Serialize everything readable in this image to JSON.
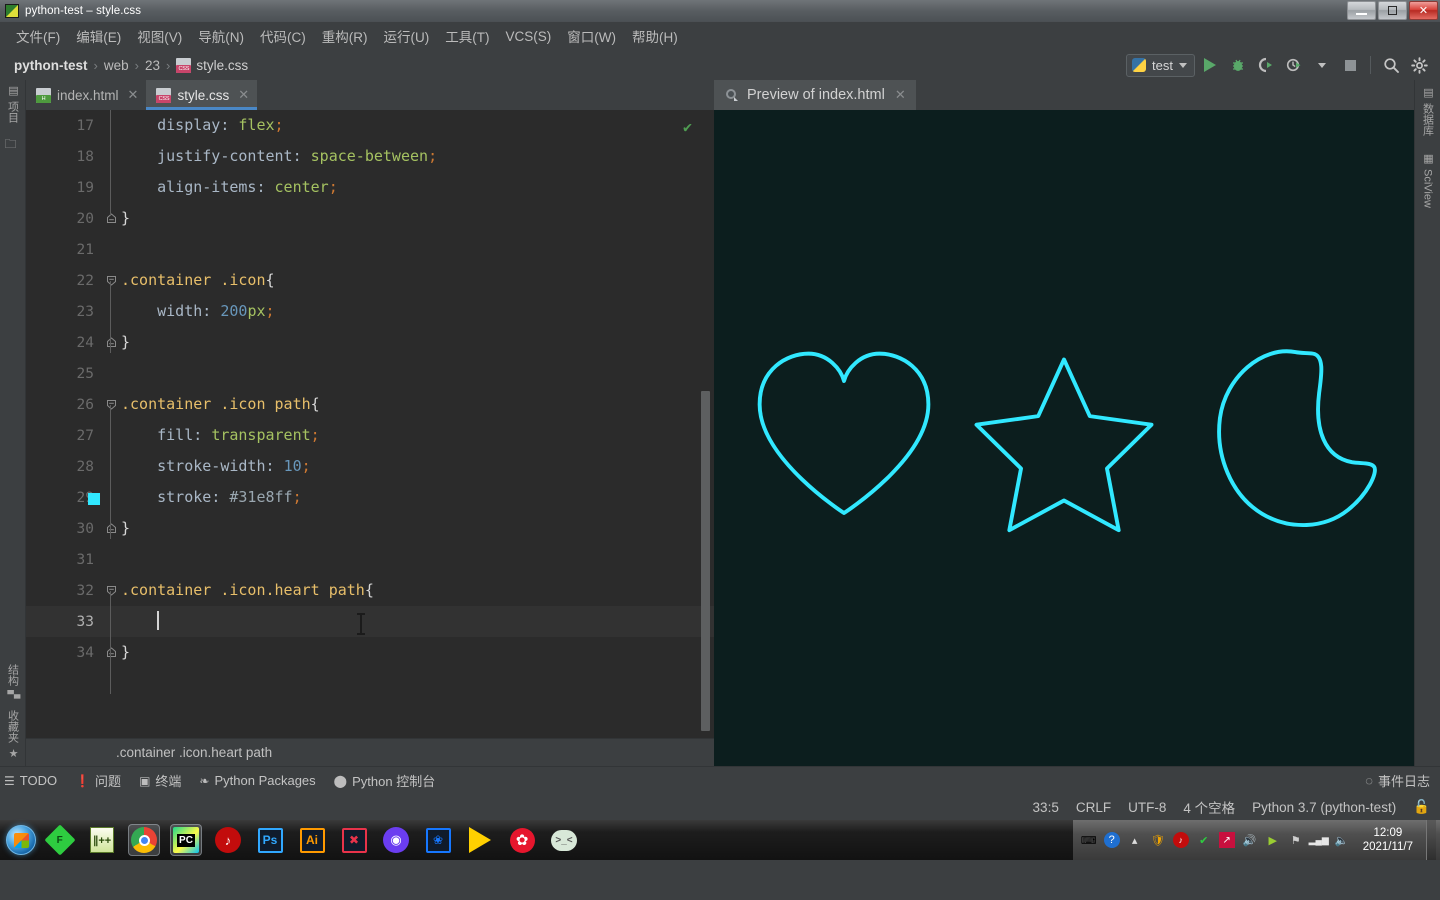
{
  "window": {
    "title": "python-test – style.css",
    "icon": "pycharm-icon",
    "buttons": {
      "minimize": "—",
      "maximize": "❐",
      "close": "✕"
    }
  },
  "menubar": {
    "items": [
      {
        "label": "文件(F)",
        "name": "menu-file"
      },
      {
        "label": "编辑(E)",
        "name": "menu-edit"
      },
      {
        "label": "视图(V)",
        "name": "menu-view"
      },
      {
        "label": "导航(N)",
        "name": "menu-navigate"
      },
      {
        "label": "代码(C)",
        "name": "menu-code"
      },
      {
        "label": "重构(R)",
        "name": "menu-refactor"
      },
      {
        "label": "运行(U)",
        "name": "menu-run"
      },
      {
        "label": "工具(T)",
        "name": "menu-tools"
      },
      {
        "label": "VCS(S)",
        "name": "menu-vcs"
      },
      {
        "label": "窗口(W)",
        "name": "menu-window"
      },
      {
        "label": "帮助(H)",
        "name": "menu-help"
      }
    ]
  },
  "toolbar": {
    "breadcrumb": {
      "project": "python-test",
      "folder": "web",
      "subfolder": "23",
      "file": "style.css",
      "separator": "›"
    },
    "run_config": {
      "label": "test",
      "icon": "python-icon"
    },
    "actions": [
      {
        "name": "run-button",
        "glyph": "▶"
      },
      {
        "name": "debug-button",
        "glyph": "🐞"
      },
      {
        "name": "run-with-coverage-button",
        "glyph": "▶"
      },
      {
        "name": "profile-button",
        "glyph": "▶"
      },
      {
        "name": "stop-button",
        "glyph": "■"
      },
      {
        "name": "search-everywhere-button",
        "glyph": "🔍"
      },
      {
        "name": "settings-button",
        "glyph": "⚙"
      }
    ]
  },
  "left_rail": {
    "top": [
      {
        "label": "项目",
        "name": "tool-window-project",
        "icon": "project-icon"
      },
      {
        "label": "",
        "name": "tool-window-folder",
        "icon": "folder-icon"
      }
    ],
    "bottom": [
      {
        "label": "结构",
        "name": "tool-window-structure",
        "icon": "structure-icon"
      },
      {
        "label": "收藏夹",
        "name": "tool-window-favorites",
        "icon": "star-icon"
      }
    ]
  },
  "right_rail": {
    "items": [
      {
        "label": "数据库",
        "name": "tool-window-database",
        "icon": "database-icon"
      },
      {
        "label": "SciView",
        "name": "tool-window-sciview",
        "icon": "grid-icon"
      }
    ]
  },
  "editor": {
    "tabs": [
      {
        "label": "index.html",
        "name": "editor-tab-index-html",
        "badge": "H",
        "active": false
      },
      {
        "label": "style.css",
        "name": "editor-tab-style-css",
        "badge": "CSS",
        "active": true
      }
    ],
    "breadcrumb_status": ".container .icon.heart path",
    "inspection_ok": "✔",
    "color_swatch": "#31e8ff",
    "lines": [
      {
        "no": "17",
        "indent": 2,
        "fold": "",
        "current": false,
        "tokens": [
          {
            "t": "display",
            "c": "prop"
          },
          {
            "t": ": ",
            "c": "punc2"
          },
          {
            "t": "flex",
            "c": "val"
          },
          {
            "t": ";",
            "c": "punc"
          }
        ]
      },
      {
        "no": "18",
        "indent": 2,
        "fold": "",
        "current": false,
        "tokens": [
          {
            "t": "justify-content",
            "c": "prop"
          },
          {
            "t": ": ",
            "c": "punc2"
          },
          {
            "t": "space-between",
            "c": "val"
          },
          {
            "t": ";",
            "c": "punc"
          }
        ]
      },
      {
        "no": "19",
        "indent": 2,
        "fold": "",
        "current": false,
        "tokens": [
          {
            "t": "align-items",
            "c": "prop"
          },
          {
            "t": ": ",
            "c": "punc2"
          },
          {
            "t": "center",
            "c": "val"
          },
          {
            "t": ";",
            "c": "punc"
          }
        ]
      },
      {
        "no": "20",
        "indent": 0,
        "fold": "end",
        "current": false,
        "tokens": [
          {
            "t": "}",
            "c": "brace"
          }
        ]
      },
      {
        "no": "21",
        "indent": 0,
        "fold": "",
        "current": false,
        "tokens": []
      },
      {
        "no": "22",
        "indent": 0,
        "fold": "start",
        "current": false,
        "tokens": [
          {
            "t": ".container .icon",
            "c": "sel"
          },
          {
            "t": "{",
            "c": "brace"
          }
        ]
      },
      {
        "no": "23",
        "indent": 2,
        "fold": "",
        "current": false,
        "tokens": [
          {
            "t": "width",
            "c": "prop"
          },
          {
            "t": ": ",
            "c": "punc2"
          },
          {
            "t": "200",
            "c": "num"
          },
          {
            "t": "px",
            "c": "val"
          },
          {
            "t": ";",
            "c": "punc"
          }
        ]
      },
      {
        "no": "24",
        "indent": 0,
        "fold": "end",
        "current": false,
        "tokens": [
          {
            "t": "}",
            "c": "brace"
          }
        ]
      },
      {
        "no": "25",
        "indent": 0,
        "fold": "",
        "current": false,
        "tokens": []
      },
      {
        "no": "26",
        "indent": 0,
        "fold": "start",
        "current": false,
        "tokens": [
          {
            "t": ".container .icon path",
            "c": "sel"
          },
          {
            "t": "{",
            "c": "brace"
          }
        ]
      },
      {
        "no": "27",
        "indent": 2,
        "fold": "",
        "current": false,
        "tokens": [
          {
            "t": "fill",
            "c": "prop"
          },
          {
            "t": ": ",
            "c": "punc2"
          },
          {
            "t": "transparent",
            "c": "val"
          },
          {
            "t": ";",
            "c": "punc"
          }
        ]
      },
      {
        "no": "28",
        "indent": 2,
        "fold": "",
        "current": false,
        "tokens": [
          {
            "t": "stroke-width",
            "c": "prop"
          },
          {
            "t": ": ",
            "c": "punc2"
          },
          {
            "t": "10",
            "c": "num"
          },
          {
            "t": ";",
            "c": "punc"
          }
        ]
      },
      {
        "no": "29",
        "indent": 2,
        "fold": "",
        "current": false,
        "swatch": "#31e8ff",
        "tokens": [
          {
            "t": "stroke",
            "c": "prop"
          },
          {
            "t": ": ",
            "c": "punc2"
          },
          {
            "t": "#31e8ff",
            "c": "color"
          },
          {
            "t": ";",
            "c": "punc"
          }
        ]
      },
      {
        "no": "30",
        "indent": 0,
        "fold": "end",
        "current": false,
        "tokens": [
          {
            "t": "}",
            "c": "brace"
          }
        ]
      },
      {
        "no": "31",
        "indent": 0,
        "fold": "",
        "current": false,
        "tokens": []
      },
      {
        "no": "32",
        "indent": 0,
        "fold": "start",
        "current": false,
        "tokens": [
          {
            "t": ".container .icon.heart path",
            "c": "sel"
          },
          {
            "t": "{",
            "c": "brace"
          }
        ]
      },
      {
        "no": "33",
        "indent": 2,
        "fold": "",
        "current": true,
        "cursor": true,
        "tokens": []
      },
      {
        "no": "34",
        "indent": 0,
        "fold": "end",
        "current": false,
        "tokens": [
          {
            "t": "}",
            "c": "brace"
          }
        ]
      }
    ]
  },
  "preview": {
    "tab_label": "Preview of index.html",
    "tab_icon": "preview-icon",
    "close": "✕",
    "background": "#0c1e1e",
    "stroke_color": "#31e8ff",
    "stroke_width": 10,
    "shapes": [
      {
        "name": "heart-shape",
        "label": "heart"
      },
      {
        "name": "star-shape",
        "label": "star"
      },
      {
        "name": "moon-shape",
        "label": "moon"
      }
    ]
  },
  "bottom_bar": {
    "items": [
      {
        "label": "TODO",
        "name": "tool-window-todo",
        "icon": "list-icon"
      },
      {
        "label": "问题",
        "name": "tool-window-problems",
        "icon": "warning-icon"
      },
      {
        "label": "终端",
        "name": "tool-window-terminal",
        "icon": "terminal-icon"
      },
      {
        "label": "Python Packages",
        "name": "tool-window-python-packages",
        "icon": "layers-icon"
      },
      {
        "label": "Python 控制台",
        "name": "tool-window-python-console",
        "icon": "python-icon"
      }
    ],
    "event_log": {
      "label": "事件日志",
      "name": "event-log-button",
      "icon": "balloon-icon"
    }
  },
  "statusbar": {
    "caret_position": "33:5",
    "line_separator": "CRLF",
    "encoding": "UTF-8",
    "indent": "4 个空格",
    "interpreter": "Python 3.7 (python-test)",
    "lock_icon": "lock-icon"
  },
  "taskbar": {
    "start": "start-orb",
    "apps": [
      {
        "name": "taskbar-foxmail",
        "glyph": "F",
        "color": "#2ecc40",
        "shape": "diamond",
        "running": false
      },
      {
        "name": "taskbar-notepadpp",
        "glyph": "N",
        "color": "#9ad14b",
        "shape": "note",
        "running": false
      },
      {
        "name": "taskbar-chrome",
        "glyph": "",
        "color": "#4285f4",
        "shape": "chrome",
        "running": true
      },
      {
        "name": "taskbar-pycharm",
        "glyph": "PC",
        "color": "#21d789",
        "shape": "pycharm",
        "running": true
      },
      {
        "name": "taskbar-netease-music",
        "glyph": "♪",
        "color": "#c20c0c",
        "shape": "circle",
        "running": false
      },
      {
        "name": "taskbar-photoshop",
        "glyph": "Ps",
        "color": "#31a8ff",
        "shape": "square",
        "running": false
      },
      {
        "name": "taskbar-illustrator",
        "glyph": "Ai",
        "color": "#ff9a00",
        "shape": "square",
        "running": false
      },
      {
        "name": "taskbar-xmind",
        "glyph": "✖",
        "color": "#e8334a",
        "shape": "square",
        "running": false
      },
      {
        "name": "taskbar-quark",
        "glyph": "◉",
        "color": "#6b3df0",
        "shape": "circle",
        "running": false
      },
      {
        "name": "taskbar-alipay",
        "glyph": "❀",
        "color": "#1677ff",
        "shape": "square",
        "running": false
      },
      {
        "name": "taskbar-tencent-video",
        "glyph": "▶",
        "color": "#ffd000",
        "shape": "play",
        "running": false
      },
      {
        "name": "taskbar-weibo",
        "glyph": "✿",
        "color": "#e6162d",
        "shape": "flower",
        "running": false
      },
      {
        "name": "taskbar-wechat",
        "glyph": "💬",
        "color": "#d8e8d8",
        "shape": "bubble",
        "running": false
      }
    ],
    "tray": [
      {
        "name": "tray-keyboard-icon",
        "glyph": "⌨"
      },
      {
        "name": "tray-help-icon",
        "glyph": "?"
      },
      {
        "name": "tray-show-hidden-icon",
        "glyph": "▴"
      },
      {
        "name": "tray-security-icon",
        "glyph": "🛡"
      },
      {
        "name": "tray-netease-icon",
        "glyph": "♪"
      },
      {
        "name": "tray-antivirus-icon",
        "glyph": "✓"
      },
      {
        "name": "tray-app-icon",
        "glyph": "↗"
      },
      {
        "name": "tray-volume-alt-icon",
        "glyph": "🔊"
      },
      {
        "name": "tray-media-icon",
        "glyph": "▶"
      },
      {
        "name": "tray-network-error-icon",
        "glyph": "⚑"
      },
      {
        "name": "tray-signal-icon",
        "glyph": "▂▄▆"
      },
      {
        "name": "tray-volume-icon",
        "glyph": "🔈"
      }
    ],
    "clock": {
      "time": "12:09",
      "date": "2021/11/7"
    }
  }
}
